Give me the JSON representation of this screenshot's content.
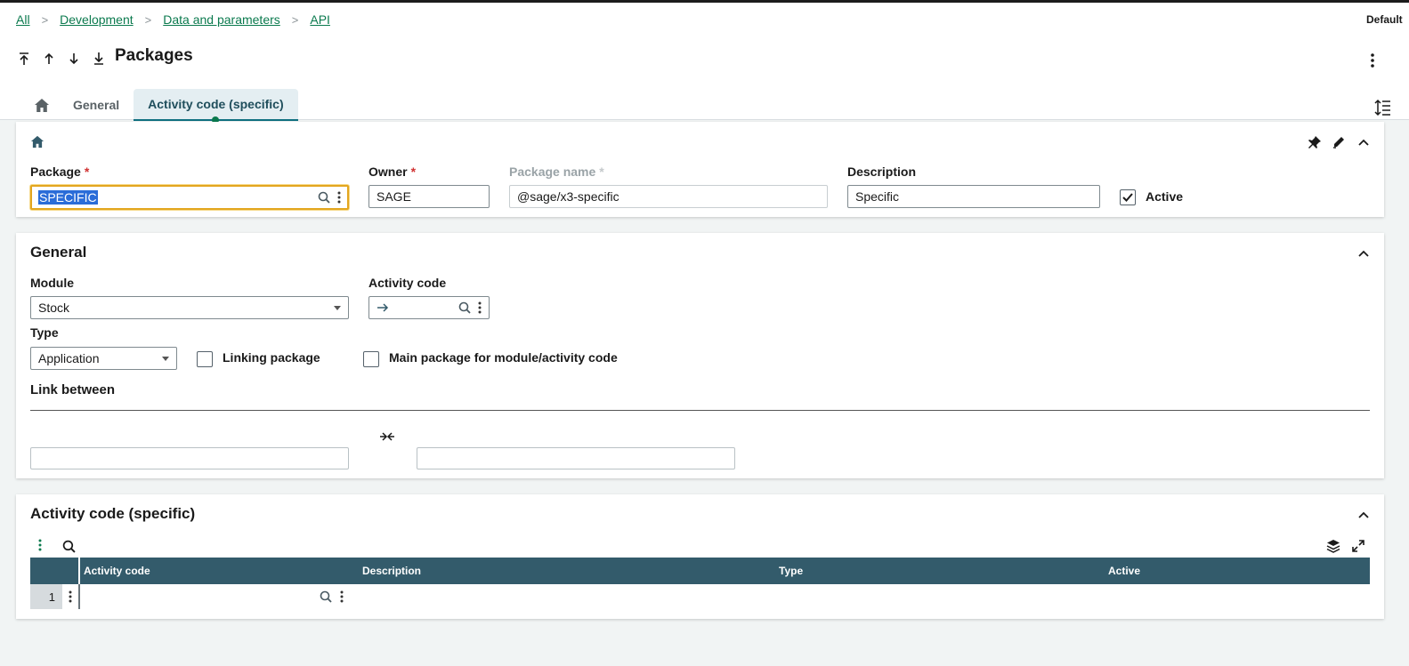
{
  "breadcrumb": {
    "items": [
      {
        "label": "All"
      },
      {
        "label": "Development"
      },
      {
        "label": "Data and parameters"
      },
      {
        "label": "API"
      }
    ]
  },
  "header": {
    "default_label": "Default",
    "title": "Packages"
  },
  "tabs": [
    {
      "label": "General"
    },
    {
      "label": "Activity code (specific)"
    }
  ],
  "package_section": {
    "package": {
      "label": "Package",
      "value": "SPECIFIC"
    },
    "owner": {
      "label": "Owner",
      "value": "SAGE"
    },
    "package_name": {
      "label": "Package name",
      "value": "@sage/x3-specific"
    },
    "description": {
      "label": "Description",
      "value": "Specific"
    },
    "active": {
      "label": "Active",
      "checked": true
    }
  },
  "general_section": {
    "title": "General",
    "module": {
      "label": "Module",
      "value": "Stock"
    },
    "activity_code": {
      "label": "Activity code",
      "value": ""
    },
    "type": {
      "label": "Type",
      "value": "Application"
    },
    "linking_package": {
      "label": "Linking package",
      "checked": false
    },
    "main_package": {
      "label": "Main package for module/activity code",
      "checked": false
    },
    "link_between": {
      "label": "Link between"
    }
  },
  "activity_section": {
    "title": "Activity code (specific)",
    "columns": [
      "Activity code",
      "Description",
      "Type",
      "Active"
    ],
    "rows": [
      {
        "num": "1"
      }
    ]
  },
  "colors": {
    "link": "#0b7a4e",
    "grid_header": "#335b6b",
    "focus": "#e3a61f",
    "required": "#d03232"
  }
}
